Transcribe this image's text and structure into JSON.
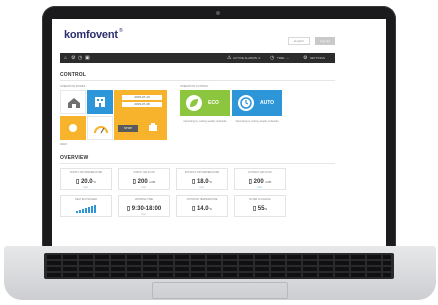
{
  "app": {
    "brand": "komfovent",
    "brand_mark": "®",
    "lang_label": "English",
    "logout_label": "Log out"
  },
  "topbar": {
    "alarm_label": "ACTIVE ALARMS: 0",
    "time_label": "TIME: ---",
    "settings_label": "SETTINGS"
  },
  "control": {
    "heading": "CONTROL",
    "left_sub": "OPERATION MODES",
    "right_sub": "OPERATION CONTROL",
    "date1": "2015-07-13",
    "date2": "2015-07-28",
    "eco_label": "ECO",
    "auto_label": "AUTO",
    "eco_note": "Operating by setting weekly schedule",
    "auto_note": "Operating by setting weekly schedule",
    "mode_label": "AWAY",
    "stop_label": "STOP"
  },
  "overview": {
    "heading": "OVERVIEW",
    "cards": [
      {
        "title": "SUPPLY AIR TEMPERATURE",
        "value": "20.0",
        "unit": "°C",
        "link": "EDIT"
      },
      {
        "title": "SUPPLY AIR FLOW",
        "value": "200",
        "unit": "m³/h",
        "link": "EDIT"
      },
      {
        "title": "EXTRACT AIR TEMPERATURE",
        "value": "18.0",
        "unit": "°C",
        "link": "EDIT"
      },
      {
        "title": "EXTRACT AIR FLOW",
        "value": "200",
        "unit": "m³/h",
        "link": "EDIT"
      },
      {
        "title": "HEAT EXCHANGER",
        "value": "",
        "unit": "",
        "link": ""
      },
      {
        "title": "WORKING TIME",
        "value": "9:30-18:00",
        "unit": "",
        "link": "EDIT"
      },
      {
        "title": "OUTDOOR TEMPERATURE",
        "value": "14.0",
        "unit": "°C",
        "link": ""
      },
      {
        "title": "FILTER CLOGGING",
        "value": "55",
        "unit": "%",
        "link": ""
      }
    ]
  },
  "colors": {
    "topbar": "#2b2b2b",
    "eco": "#8cc63e",
    "auto": "#2d96d9",
    "mode_blue": "#2d96d9",
    "mode_orange": "#f7b32b",
    "brand": "#2c2f6e"
  },
  "icons": [
    "home-icon",
    "building-icon",
    "sun-icon",
    "gauge-icon",
    "calendar-icon",
    "thermometer-icon",
    "fan-icon",
    "filter-icon",
    "alarm-icon",
    "clock-icon",
    "gear-icon"
  ]
}
